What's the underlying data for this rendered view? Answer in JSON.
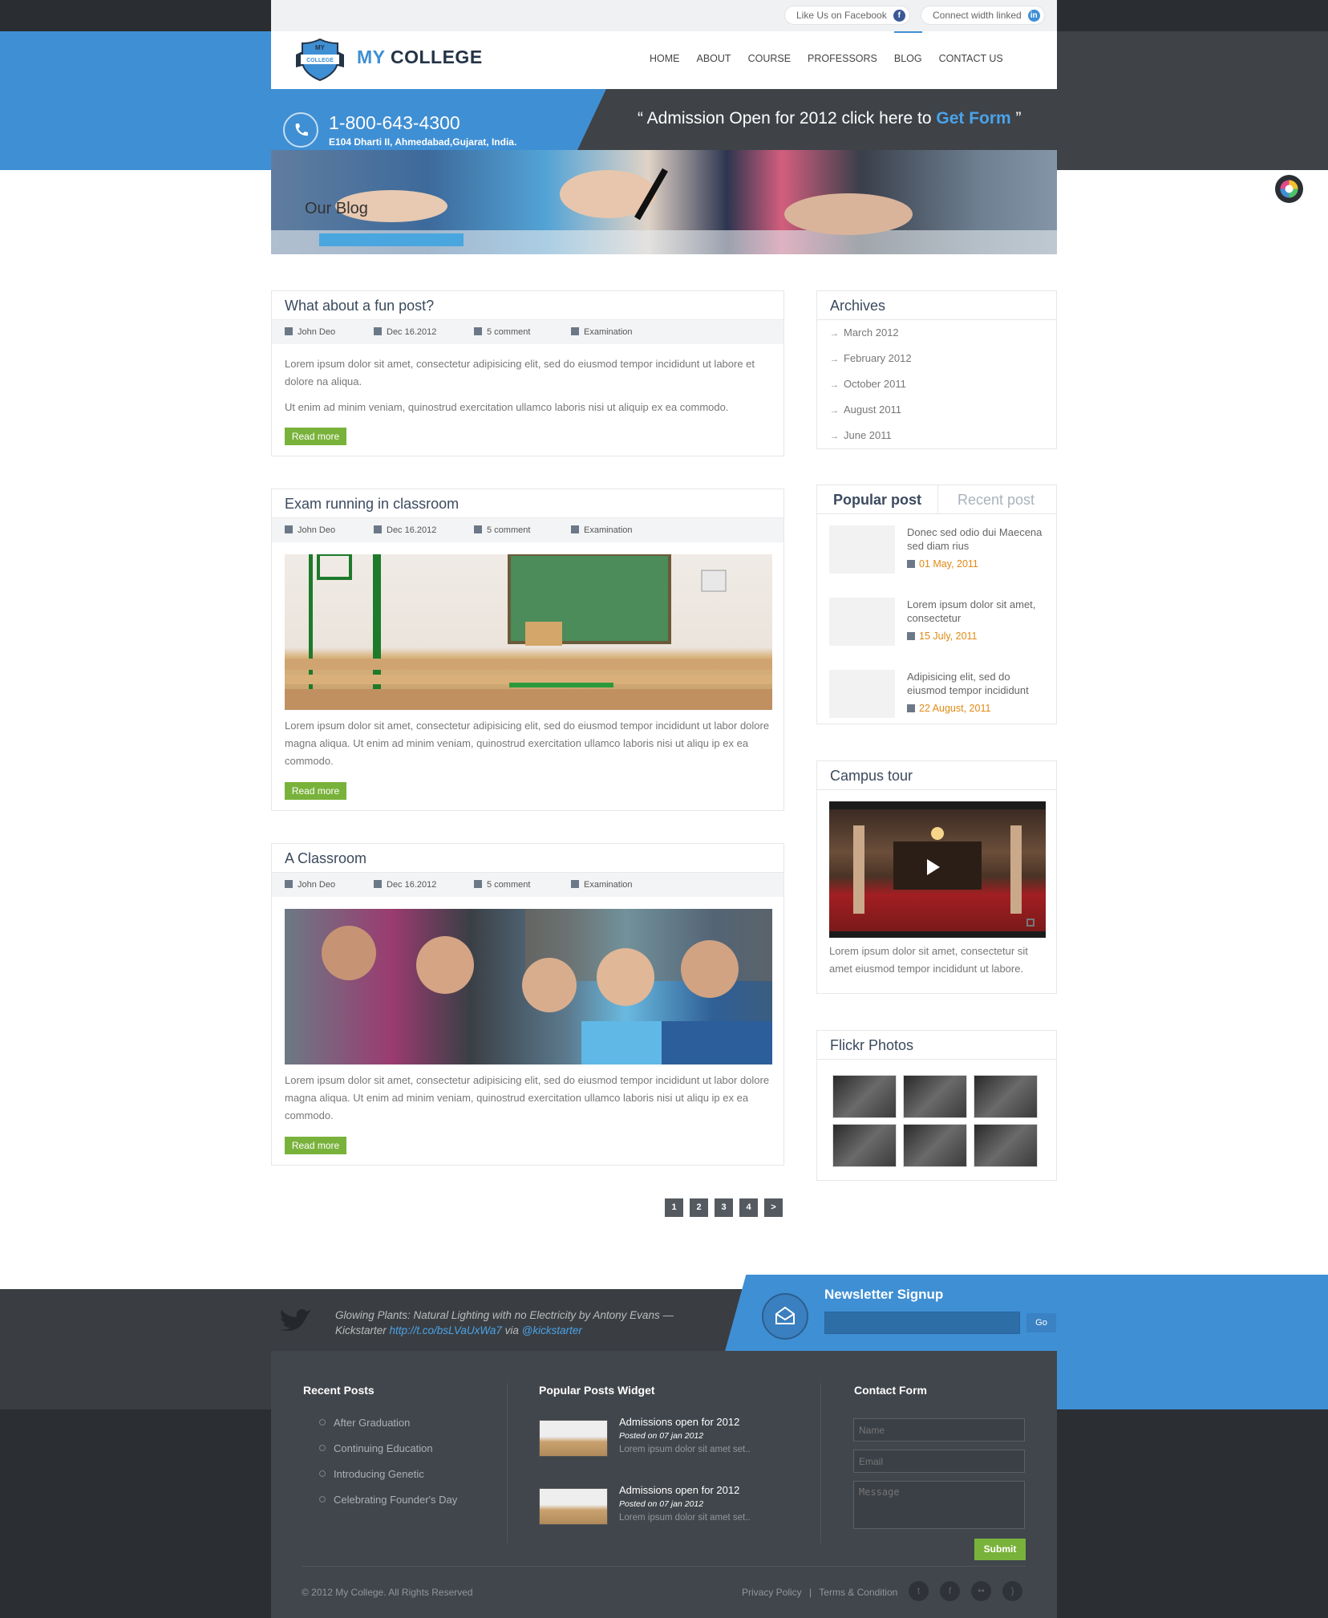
{
  "topbar": {
    "facebook_label": "Like Us on Facebook",
    "linkedin_label": "Connect width linked",
    "facebook_icon": "f",
    "linkedin_icon": "in"
  },
  "logo": {
    "badge_top": "MY",
    "badge_bottom": "COLLEGE",
    "text_a": "MY",
    "text_b": "COLLEGE"
  },
  "nav": [
    "HOME",
    "ABOUT",
    "COURSE",
    "PROFESSORS",
    "BLOG",
    "CONTACT US"
  ],
  "contact": {
    "phone": "1-800-643-4300",
    "address": "E104 Dharti II, Ahmedabad,Gujarat, India."
  },
  "notice": {
    "prefix": "“ Admission Open for 2012 click here to ",
    "link": "Get Form",
    "suffix": " ”"
  },
  "banner": {
    "title": "Our Blog"
  },
  "posts": [
    {
      "title": "What about a fun post?",
      "author": "John Deo",
      "date": "Dec 16.2012",
      "comments": "5 comment",
      "category": "Examination",
      "p1": "Lorem ipsum dolor sit amet, consectetur adipisicing elit, sed do eiusmod tempor incididunt ut labore et dolore na aliqua.",
      "p2": "Ut enim ad minim veniam, quinostrud exercitation ullamco laboris nisi ut aliquip ex ea commodo.",
      "button": "Read more"
    },
    {
      "title": "Exam running in classroom",
      "author": "John Deo",
      "date": "Dec 16.2012",
      "comments": "5 comment",
      "category": "Examination",
      "p1": "Lorem ipsum dolor sit amet, consectetur adipisicing elit, sed do eiusmod tempor incididunt ut labor dolore magna aliqua. Ut enim ad minim veniam, quinostrud exercitation ullamco laboris nisi ut aliqu ip ex ea commodo.",
      "button": "Read more"
    },
    {
      "title": "A Classroom",
      "author": "John Deo",
      "date": "Dec 16.2012",
      "comments": "5 comment",
      "category": "Examination",
      "p1": "Lorem ipsum dolor sit amet, consectetur adipisicing elit, sed do eiusmod tempor incididunt ut labor dolore magna aliqua. Ut enim ad minim veniam, quinostrud exercitation ullamco laboris nisi ut aliqu ip ex ea commodo.",
      "button": "Read more"
    }
  ],
  "pagination": [
    "1",
    "2",
    "3",
    "4",
    ">"
  ],
  "archives": {
    "title": "Archives",
    "items": [
      "March 2012",
      "February 2012",
      "October 2011",
      "August 2011",
      "June 2011"
    ]
  },
  "tabs": {
    "active": "Popular post",
    "inactive": "Recent post",
    "items": [
      {
        "text": "Donec sed odio dui Maecena sed diam rius",
        "date": "01 May, 2011"
      },
      {
        "text": "Lorem ipsum dolor sit amet, consectetur",
        "date": "15 July, 2011"
      },
      {
        "text": "Adipisicing elit, sed do eiusmod tempor incididunt",
        "date": "22 August, 2011"
      }
    ]
  },
  "campus": {
    "title": "Campus tour",
    "caption": "Lorem ipsum dolor sit amet, consectetur sit amet eiusmod tempor incididunt ut labore."
  },
  "flickr": {
    "title": "Flickr Photos"
  },
  "footer": {
    "tweet_text": "Glowing Plants: Natural Lighting with no Electricity by Antony Evans — Kickstarter ",
    "tweet_link": "http://t.co/bsLVaUxWa7",
    "tweet_via": " via ",
    "tweet_handle": "@kickstarter",
    "newsletter_title": "Newsletter Signup",
    "newsletter_button": "Go",
    "recent_title": "Recent Posts",
    "recent": [
      "After Graduation",
      "Continuing Education",
      "Introducing Genetic",
      "Celebrating Founder's Day"
    ],
    "popular_title": "Popular Posts Widget",
    "popular": [
      {
        "title": "Admissions open for 2012",
        "date": "Posted on 07 jan 2012",
        "text": "Lorem ipsum dolor sit amet set.."
      },
      {
        "title": "Admissions open for 2012",
        "date": "Posted on 07 jan 2012",
        "text": "Lorem ipsum dolor sit amet set.."
      }
    ],
    "contact_title": "Contact Form",
    "name_placeholder": "Name",
    "email_placeholder": "Email",
    "message_placeholder": "Message",
    "submit": "Submit",
    "copyright": "© 2012 My College. All Rights Reserved",
    "privacy": "Privacy Policy",
    "sep": "|",
    "terms": "Terms & Condition"
  },
  "colors": {
    "brand_blue": "#3f8fd4",
    "dark": "#3f4348",
    "green": "#79b23b",
    "orange": "#e08a12"
  }
}
